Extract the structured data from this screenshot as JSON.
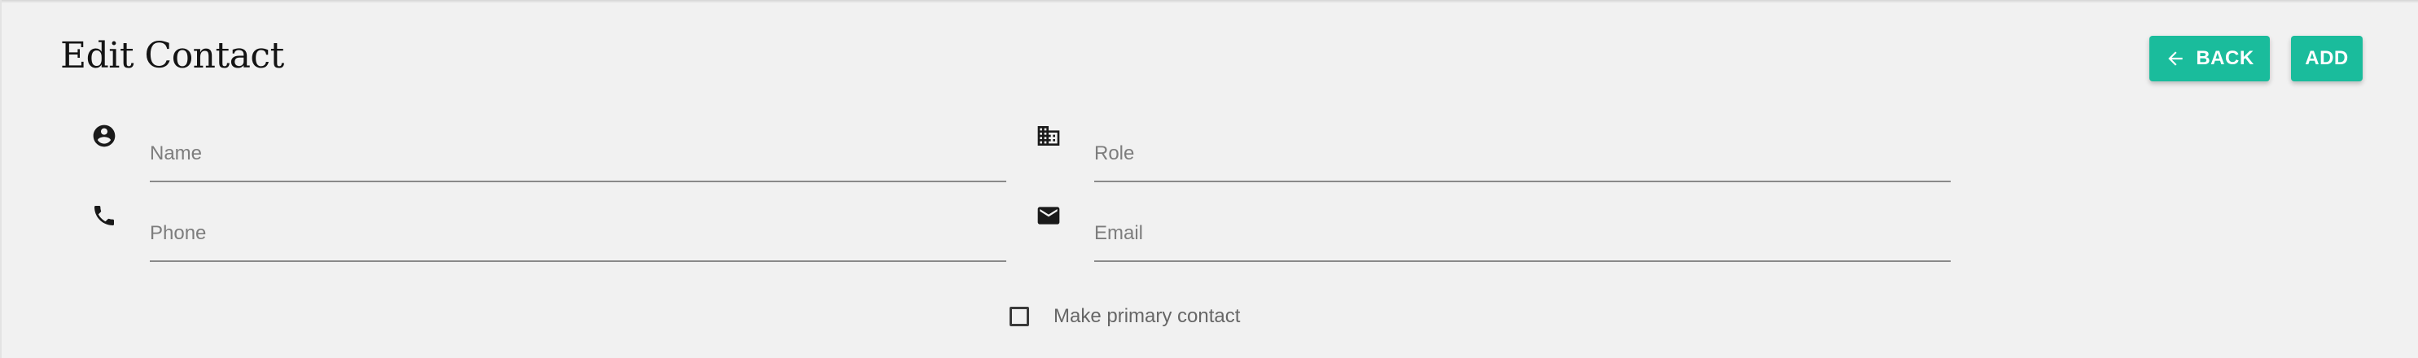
{
  "page": {
    "title": "Edit Contact"
  },
  "actions": {
    "back_label": "BACK",
    "add_label": "ADD",
    "accent_color": "#1abc9c"
  },
  "form": {
    "name": {
      "placeholder": "Name",
      "value": "",
      "icon": "account-circle-icon"
    },
    "role": {
      "placeholder": "Role",
      "value": "",
      "icon": "business-icon"
    },
    "phone": {
      "placeholder": "Phone",
      "value": "",
      "icon": "phone-icon"
    },
    "email": {
      "placeholder": "Email",
      "value": "",
      "icon": "email-icon"
    },
    "primary_contact": {
      "label": "Make primary contact",
      "checked": false
    }
  }
}
